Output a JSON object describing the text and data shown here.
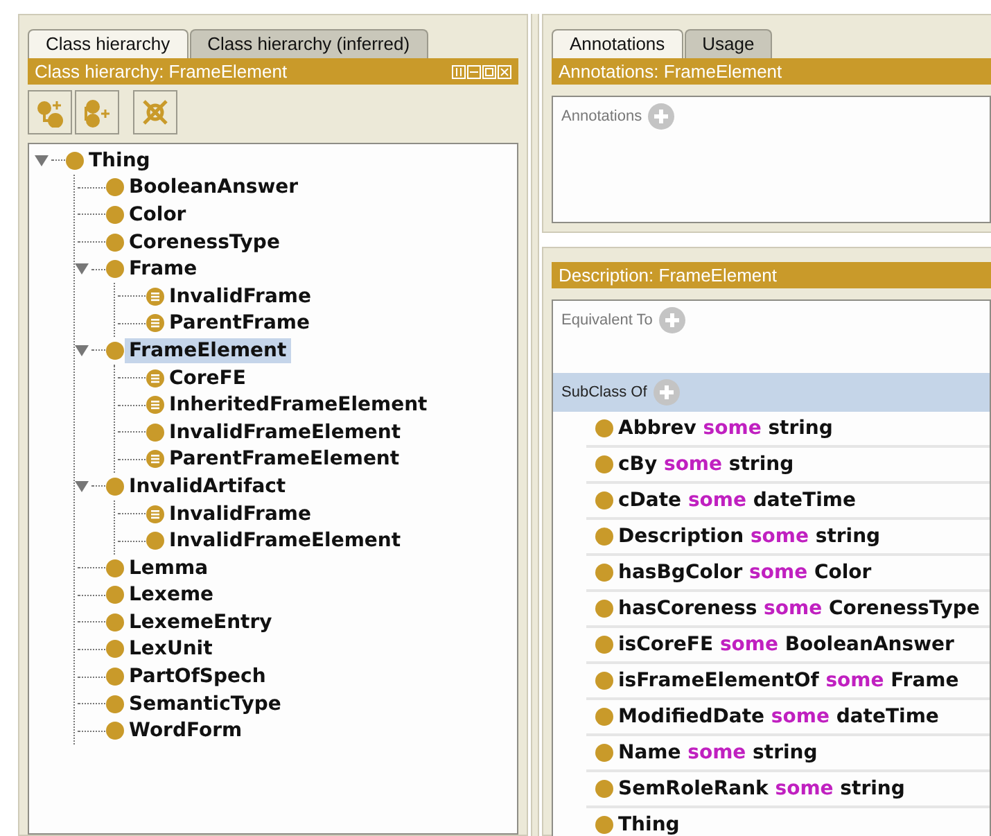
{
  "left_panel": {
    "tabs": [
      {
        "label": "Class hierarchy",
        "selected": true
      },
      {
        "label": "Class hierarchy (inferred)",
        "selected": false
      }
    ],
    "header": "Class hierarchy: FrameElement",
    "tree": [
      {
        "label": "Thing",
        "kind": "primitive",
        "selected": false,
        "expanded": true,
        "children": [
          {
            "label": "BooleanAnswer",
            "kind": "primitive",
            "selected": false
          },
          {
            "label": "Color",
            "kind": "primitive",
            "selected": false
          },
          {
            "label": "CorenessType",
            "kind": "primitive",
            "selected": false
          },
          {
            "label": "Frame",
            "kind": "primitive",
            "selected": false,
            "expanded": true,
            "children": [
              {
                "label": "InvalidFrame",
                "kind": "defined",
                "selected": false
              },
              {
                "label": "ParentFrame",
                "kind": "defined",
                "selected": false
              }
            ]
          },
          {
            "label": "FrameElement",
            "kind": "primitive",
            "selected": true,
            "expanded": true,
            "children": [
              {
                "label": "CoreFE",
                "kind": "defined",
                "selected": false
              },
              {
                "label": "InheritedFrameElement",
                "kind": "defined",
                "selected": false
              },
              {
                "label": "InvalidFrameElement",
                "kind": "primitive",
                "selected": false
              },
              {
                "label": "ParentFrameElement",
                "kind": "defined",
                "selected": false
              }
            ]
          },
          {
            "label": "InvalidArtifact",
            "kind": "primitive",
            "selected": false,
            "expanded": true,
            "children": [
              {
                "label": "InvalidFrame",
                "kind": "defined",
                "selected": false
              },
              {
                "label": "InvalidFrameElement",
                "kind": "primitive",
                "selected": false
              }
            ]
          },
          {
            "label": "Lemma",
            "kind": "primitive",
            "selected": false
          },
          {
            "label": "Lexeme",
            "kind": "primitive",
            "selected": false
          },
          {
            "label": "LexemeEntry",
            "kind": "primitive",
            "selected": false
          },
          {
            "label": "LexUnit",
            "kind": "primitive",
            "selected": false
          },
          {
            "label": "PartOfSpech",
            "kind": "primitive",
            "selected": false
          },
          {
            "label": "SemanticType",
            "kind": "primitive",
            "selected": false
          },
          {
            "label": "WordForm",
            "kind": "primitive",
            "selected": false
          }
        ]
      }
    ]
  },
  "right_panel": {
    "tabs": [
      {
        "label": "Annotations",
        "selected": true
      },
      {
        "label": "Usage",
        "selected": false
      }
    ],
    "annotations": {
      "header": "Annotations: FrameElement",
      "label": "Annotations"
    },
    "description": {
      "header": "Description: FrameElement",
      "sections": [
        {
          "label": "Equivalent To",
          "selected": false
        },
        {
          "label": "SubClass Of",
          "selected": true
        }
      ],
      "superclasses": [
        {
          "name": "Abbrev",
          "quantifier": "some",
          "filler": "string"
        },
        {
          "name": "cBy",
          "quantifier": "some",
          "filler": "string"
        },
        {
          "name": "cDate",
          "quantifier": "some",
          "filler": "dateTime"
        },
        {
          "name": "Description",
          "quantifier": "some",
          "filler": "string"
        },
        {
          "name": "hasBgColor",
          "quantifier": "some",
          "filler": "Color"
        },
        {
          "name": "hasCoreness",
          "quantifier": "some",
          "filler": "CorenessType"
        },
        {
          "name": "isCoreFE",
          "quantifier": "some",
          "filler": "BooleanAnswer"
        },
        {
          "name": "isFrameElementOf",
          "quantifier": "some",
          "filler": "Frame"
        },
        {
          "name": "ModifiedDate",
          "quantifier": "some",
          "filler": "dateTime"
        },
        {
          "name": "Name",
          "quantifier": "some",
          "filler": "string"
        },
        {
          "name": "SemRoleRank",
          "quantifier": "some",
          "filler": "string"
        },
        {
          "name": "Thing"
        }
      ]
    }
  }
}
